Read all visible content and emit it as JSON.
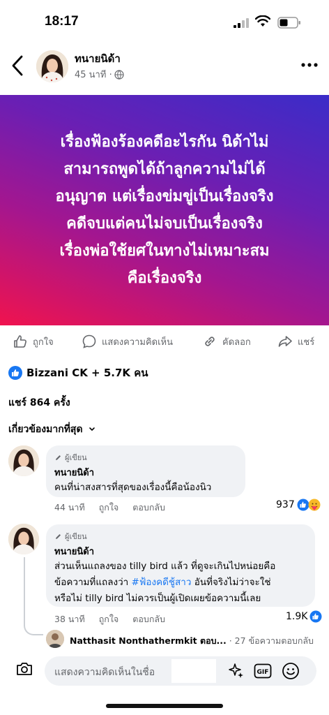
{
  "status": {
    "time": "18:17"
  },
  "header": {
    "author": "ทนายนิด้า",
    "time": "45 นาที ·"
  },
  "post": {
    "text": "เรื่องฟ้องร้องคดีอะไรกัน นิด้าไม่สามารถพูดได้ถ้าลูกความไม่ได้อนุญาต แต่เรื่องข่มขู่เป็นเรื่องจริง คดีจบแต่คนไม่จบเป็นเรื่องจริง เรื่องพ่อใช้ยศในทางไม่เหมาะสม คือเรื่องจริง",
    "lines": [
      "เรื่องฟ้องร้องคดีอะไรกัน นิด้าไม่",
      "สามารถพูดได้ถ้าลูกความไม่ได้",
      "อนุญาต แต่เรื่องข่มขู่เป็นเรื่องจริง",
      "คดีจบแต่คนไม่จบเป็นเรื่องจริง",
      "เรื่องพ่อใช้ยศในทางไม่เหมาะสม",
      "คือเรื่องจริง"
    ]
  },
  "actions": {
    "like": "ถูกใจ",
    "comment": "แสดงความคิดเห็น",
    "copy": "คัดลอก",
    "share": "แชร์"
  },
  "reactions": {
    "summary": "Bizzani CK + 5.7K คน"
  },
  "shares": "แชร์ 864 ครั้ง",
  "sort": {
    "label": "เกี่ยวข้องมากที่สุด"
  },
  "comments": [
    {
      "tag": "ผู้เขียน",
      "name": "ทนายนิด้า",
      "text": "คนที่น่าสงสารที่สุดของเรื่องนี้คือน้องนิว",
      "time": "44 นาที",
      "like": "ถูกใจ",
      "reply": "ตอบกลับ",
      "count": "937"
    },
    {
      "tag": "ผู้เขียน",
      "name": "ทนายนิด้า",
      "line1": "ส่วนเห็นแถลงของ tilly bird แล้ว ที่ดูจะเกินไปหน่อยคือ",
      "line2a": "ข้อความที่แถลงว่า ",
      "hashtag": "#ฟ้องคดีชู้สาว",
      "line2b": " อันที่จริงไม่ว่าจะใช่",
      "line3": "หรือไม่ tilly bird ไม่ควรเป็นผู้เปิดเผยข้อความนี้เลย",
      "time": "38 นาที",
      "like": "ถูกใจ",
      "reply": "ตอบกลับ",
      "count": "1.9K"
    }
  ],
  "reply_preview": {
    "name": "Natthasit Nonthathermkit ตอบ...",
    "count": " · 27 ข้อความตอบกลับ"
  },
  "composer": {
    "placeholder": "แสดงความคิดเห็นในชื่อ"
  },
  "colors": {
    "accent": "#1877f2",
    "gradient_top": "#3b2cc8",
    "gradient_bottom": "#f0134e"
  },
  "icons": [
    "back-icon",
    "globe-icon",
    "more-icon",
    "like-icon",
    "comment-icon",
    "copy-icon",
    "share-icon",
    "camera-icon",
    "gif-icon",
    "emoji-icon"
  ]
}
